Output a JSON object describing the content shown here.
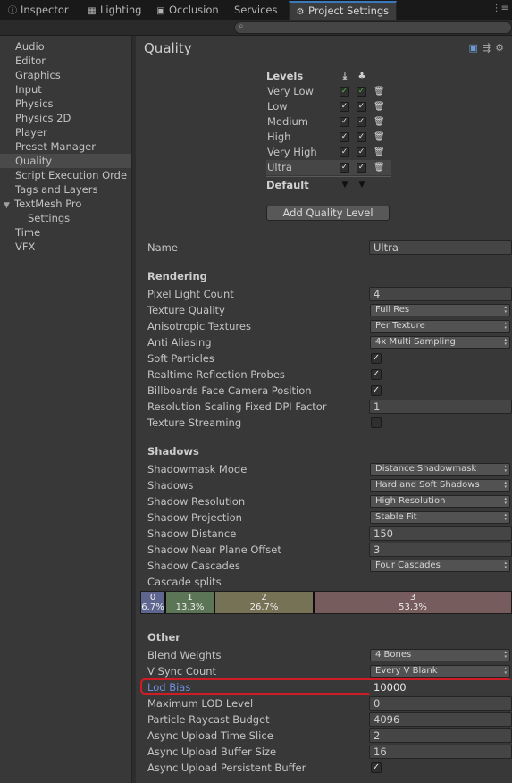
{
  "tabs": [
    {
      "label": "Inspector",
      "icon": "info-icon"
    },
    {
      "label": "Lighting",
      "icon": "lighting-icon"
    },
    {
      "label": "Occlusion",
      "icon": "occlusion-icon"
    },
    {
      "label": "Services",
      "icon": ""
    },
    {
      "label": "Project Settings",
      "icon": "gear-icon",
      "active": true
    }
  ],
  "sidebar": {
    "items": [
      {
        "label": "Audio"
      },
      {
        "label": "Editor"
      },
      {
        "label": "Graphics"
      },
      {
        "label": "Input"
      },
      {
        "label": "Physics"
      },
      {
        "label": "Physics 2D"
      },
      {
        "label": "Player"
      },
      {
        "label": "Preset Manager"
      },
      {
        "label": "Quality",
        "selected": true
      },
      {
        "label": "Script Execution Orde"
      },
      {
        "label": "Tags and Layers"
      },
      {
        "label": "TextMesh Pro",
        "expanded": true
      },
      {
        "label": "Settings",
        "child": true
      },
      {
        "label": "Time"
      },
      {
        "label": "VFX"
      }
    ]
  },
  "main": {
    "title": "Quality",
    "levels": {
      "header": "Levels",
      "platforms": [
        "download-icon",
        "android-icon"
      ],
      "rows": [
        {
          "name": "Very Low",
          "checks": [
            true,
            true
          ],
          "green": true
        },
        {
          "name": "Low",
          "checks": [
            true,
            true
          ]
        },
        {
          "name": "Medium",
          "checks": [
            true,
            true
          ]
        },
        {
          "name": "High",
          "checks": [
            true,
            true
          ]
        },
        {
          "name": "Very High",
          "checks": [
            true,
            true
          ]
        },
        {
          "name": "Ultra",
          "checks": [
            true,
            true
          ],
          "selected": true
        }
      ],
      "default_label": "Default",
      "add_button": "Add Quality Level"
    },
    "name": {
      "label": "Name",
      "value": "Ultra"
    },
    "rendering": {
      "header": "Rendering",
      "pixel_light_count": {
        "label": "Pixel Light Count",
        "value": "4"
      },
      "texture_quality": {
        "label": "Texture Quality",
        "value": "Full Res"
      },
      "anisotropic": {
        "label": "Anisotropic Textures",
        "value": "Per Texture"
      },
      "anti_aliasing": {
        "label": "Anti Aliasing",
        "value": "4x Multi Sampling"
      },
      "soft_particles": {
        "label": "Soft Particles",
        "checked": true
      },
      "realtime_reflection": {
        "label": "Realtime Reflection Probes",
        "checked": true
      },
      "billboards": {
        "label": "Billboards Face Camera Position",
        "checked": true
      },
      "dpi_factor": {
        "label": "Resolution Scaling Fixed DPI Factor",
        "value": "1"
      },
      "texture_streaming": {
        "label": "Texture Streaming",
        "checked": false
      }
    },
    "shadows": {
      "header": "Shadows",
      "shadowmask_mode": {
        "label": "Shadowmask Mode",
        "value": "Distance Shadowmask"
      },
      "shadows": {
        "label": "Shadows",
        "value": "Hard and Soft Shadows"
      },
      "resolution": {
        "label": "Shadow Resolution",
        "value": "High Resolution"
      },
      "projection": {
        "label": "Shadow Projection",
        "value": "Stable Fit"
      },
      "distance": {
        "label": "Shadow Distance",
        "value": "150"
      },
      "near_plane": {
        "label": "Shadow Near Plane Offset",
        "value": "3"
      },
      "cascades": {
        "label": "Shadow Cascades",
        "value": "Four Cascades"
      },
      "cascade_splits": {
        "label": "Cascade splits",
        "segments": [
          {
            "index": "0",
            "percent": "6.7%",
            "fraction": 0.067,
            "color": "#5e6690"
          },
          {
            "index": "1",
            "percent": "13.3%",
            "fraction": 0.133,
            "color": "#5c7557"
          },
          {
            "index": "2",
            "percent": "26.7%",
            "fraction": 0.267,
            "color": "#767255"
          },
          {
            "index": "3",
            "percent": "53.3%",
            "fraction": 0.533,
            "color": "#765c5c"
          }
        ]
      }
    },
    "other": {
      "header": "Other",
      "blend_weights": {
        "label": "Blend Weights",
        "value": "4 Bones"
      },
      "vsync": {
        "label": "V Sync Count",
        "value": "Every V Blank"
      },
      "lod_bias": {
        "label": "Lod Bias",
        "value": "10000"
      },
      "max_lod": {
        "label": "Maximum LOD Level",
        "value": "0"
      },
      "raycast_budget": {
        "label": "Particle Raycast Budget",
        "value": "4096"
      },
      "upload_time_slice": {
        "label": "Async Upload Time Slice",
        "value": "2"
      },
      "upload_buffer": {
        "label": "Async Upload Buffer Size",
        "value": "16"
      },
      "persistent_buffer": {
        "label": "Async Upload Persistent Buffer",
        "checked": true
      }
    }
  },
  "colors": {
    "accent": "#3a79bb",
    "highlight": "#d01c24",
    "lod_label": "#6e8fe0"
  }
}
